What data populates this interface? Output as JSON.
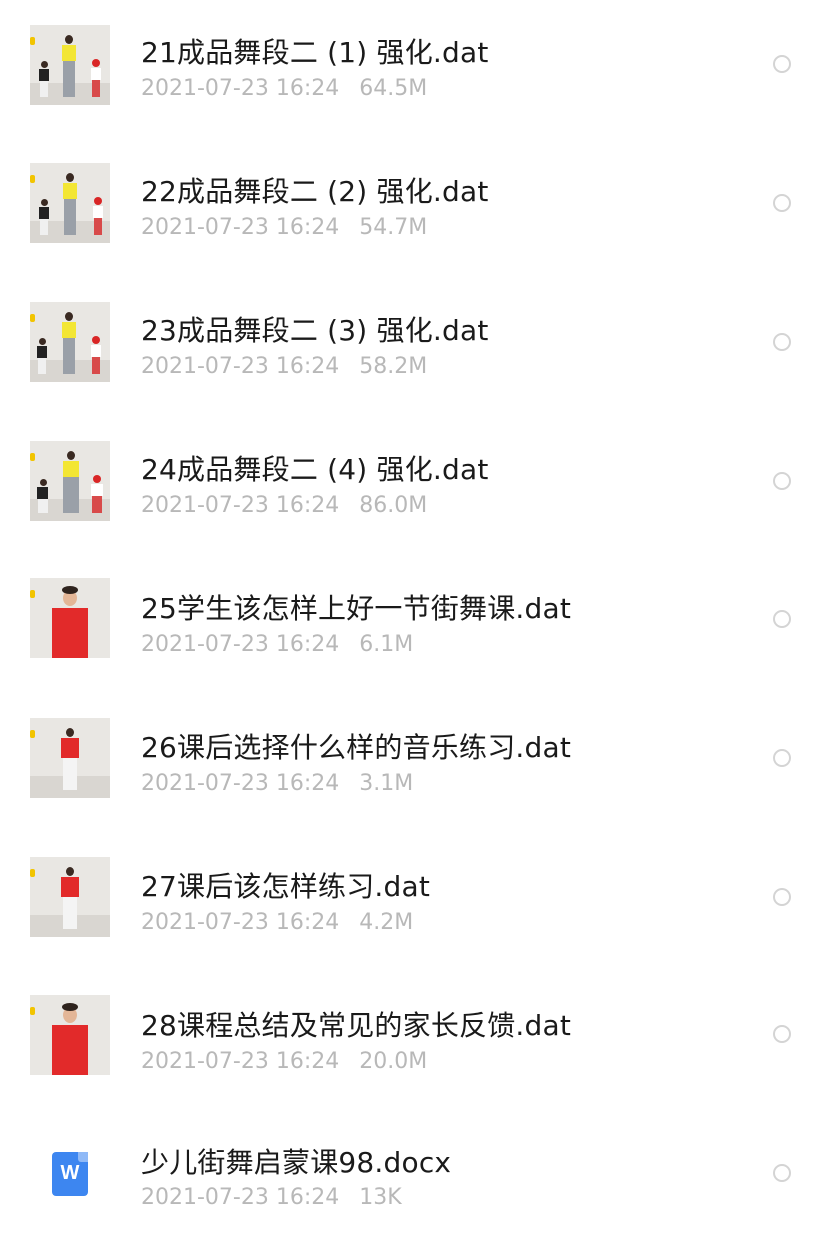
{
  "files": [
    {
      "name": "21成品舞段二 (1) 强化.dat",
      "date": "2021-07-23 16:24",
      "size": "64.5M",
      "thumb": "group-yellow",
      "icon": "video-thumbnail"
    },
    {
      "name": "22成品舞段二 (2) 强化.dat",
      "date": "2021-07-23 16:24",
      "size": "54.7M",
      "thumb": "group-yellow",
      "icon": "video-thumbnail"
    },
    {
      "name": "23成品舞段二 (3) 强化.dat",
      "date": "2021-07-23 16:24",
      "size": "58.2M",
      "thumb": "group-yellow",
      "icon": "video-thumbnail"
    },
    {
      "name": "24成品舞段二 (4) 强化.dat",
      "date": "2021-07-23 16:24",
      "size": "86.0M",
      "thumb": "group-yellow",
      "icon": "video-thumbnail"
    },
    {
      "name": "25学生该怎样上好一节街舞课.dat",
      "date": "2021-07-23 16:24",
      "size": "6.1M",
      "thumb": "single-red-close",
      "icon": "video-thumbnail"
    },
    {
      "name": "26课后选择什么样的音乐练习.dat",
      "date": "2021-07-23 16:24",
      "size": "3.1M",
      "thumb": "single-red-far",
      "icon": "video-thumbnail"
    },
    {
      "name": "27课后该怎样练习.dat",
      "date": "2021-07-23 16:24",
      "size": "4.2M",
      "thumb": "single-red-far",
      "icon": "video-thumbnail"
    },
    {
      "name": "28课程总结及常见的家长反馈.dat",
      "date": "2021-07-23 16:24",
      "size": "20.0M",
      "thumb": "single-red-close",
      "icon": "video-thumbnail"
    },
    {
      "name": "少儿街舞启蒙课98.docx",
      "date": "2021-07-23 16:24",
      "size": "13K",
      "thumb": "word-doc",
      "icon": "word-doc-icon",
      "icon_letter": "W"
    }
  ]
}
